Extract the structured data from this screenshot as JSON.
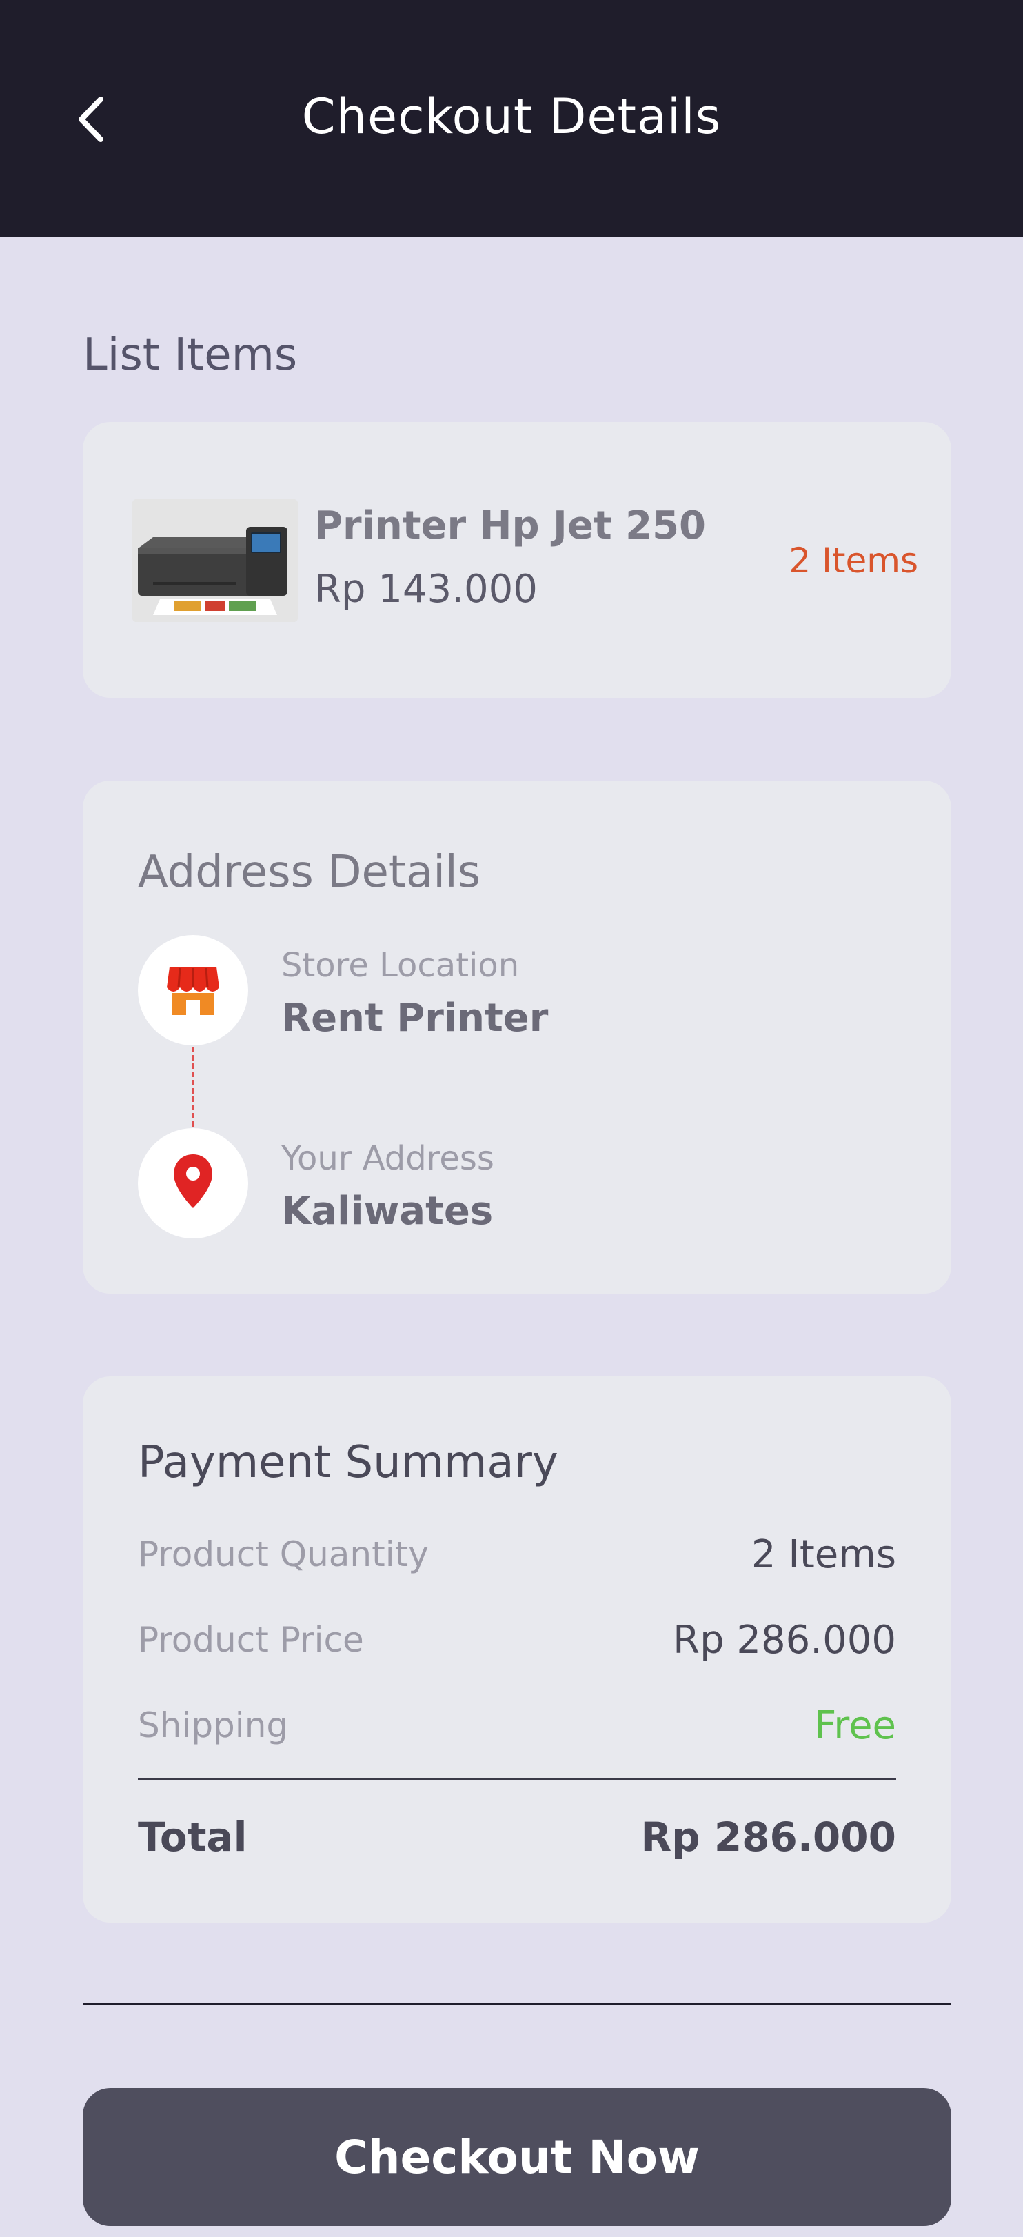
{
  "header": {
    "title": "Checkout Details",
    "back_icon": "chevron-left-icon"
  },
  "list_items": {
    "label": "List Items",
    "items": [
      {
        "name": "Printer Hp Jet 250",
        "price": "Rp 143.000",
        "quantity": "2 Items",
        "image": "printer-image"
      }
    ]
  },
  "address": {
    "title": "Address Details",
    "store": {
      "label": "Store Location",
      "value": "Rent Printer",
      "icon": "store-icon"
    },
    "customer": {
      "label": "Your Address",
      "value": "Kaliwates",
      "icon": "location-pin-icon"
    }
  },
  "payment": {
    "title": "Payment Summary",
    "rows": [
      {
        "label": "Product Quantity",
        "value": "2 Items"
      },
      {
        "label": "Product Price",
        "value": "Rp 286.000"
      },
      {
        "label": "Shipping",
        "value": "Free"
      }
    ],
    "total": {
      "label": "Total",
      "value": "Rp 286.000"
    }
  },
  "checkout": {
    "label": "Checkout Now"
  },
  "colors": {
    "header_bg": "#1f1d2b",
    "page_bg": "#e1dfee",
    "card_bg": "#e8e9ee",
    "accent_orange": "#d9552c",
    "free_green": "#5fc24e",
    "button_bg": "#4f4e5e",
    "pin_red": "#e02424"
  }
}
